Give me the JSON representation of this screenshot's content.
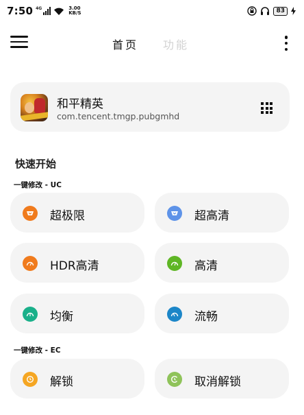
{
  "status_bar": {
    "time": "7:50",
    "network_label": "4G",
    "speed_value": "3.00",
    "speed_unit": "KB/S",
    "battery": "83"
  },
  "nav": {
    "tabs": [
      {
        "label": "首页",
        "active": true
      },
      {
        "label": "功能",
        "active": false
      }
    ]
  },
  "app": {
    "name": "和平精英",
    "package": "com.tencent.tmgp.pubgmhd"
  },
  "quick_start": {
    "title": "快速开始",
    "groups": [
      {
        "label": "一键修改 - UC",
        "buttons": [
          {
            "label": "超极限",
            "icon": "extreme-icon",
            "color": "#f07b1d"
          },
          {
            "label": "超高清",
            "icon": "ultra-hd-icon",
            "color": "#5e93e8"
          },
          {
            "label": "HDR高清",
            "icon": "gauge-icon",
            "color": "#f07b1d"
          },
          {
            "label": "高清",
            "icon": "gauge-icon",
            "color": "#5fb625"
          },
          {
            "label": "均衡",
            "icon": "gauge-icon",
            "color": "#1ab08a"
          },
          {
            "label": "流畅",
            "icon": "gauge-icon",
            "color": "#1c86c8"
          }
        ]
      },
      {
        "label": "一键修改 - EC",
        "buttons": [
          {
            "label": "解锁",
            "icon": "unlock-icon",
            "color": "#f5a623"
          },
          {
            "label": "取消解锁",
            "icon": "cancel-unlock-icon",
            "color": "#8fc35a"
          }
        ]
      }
    ]
  }
}
